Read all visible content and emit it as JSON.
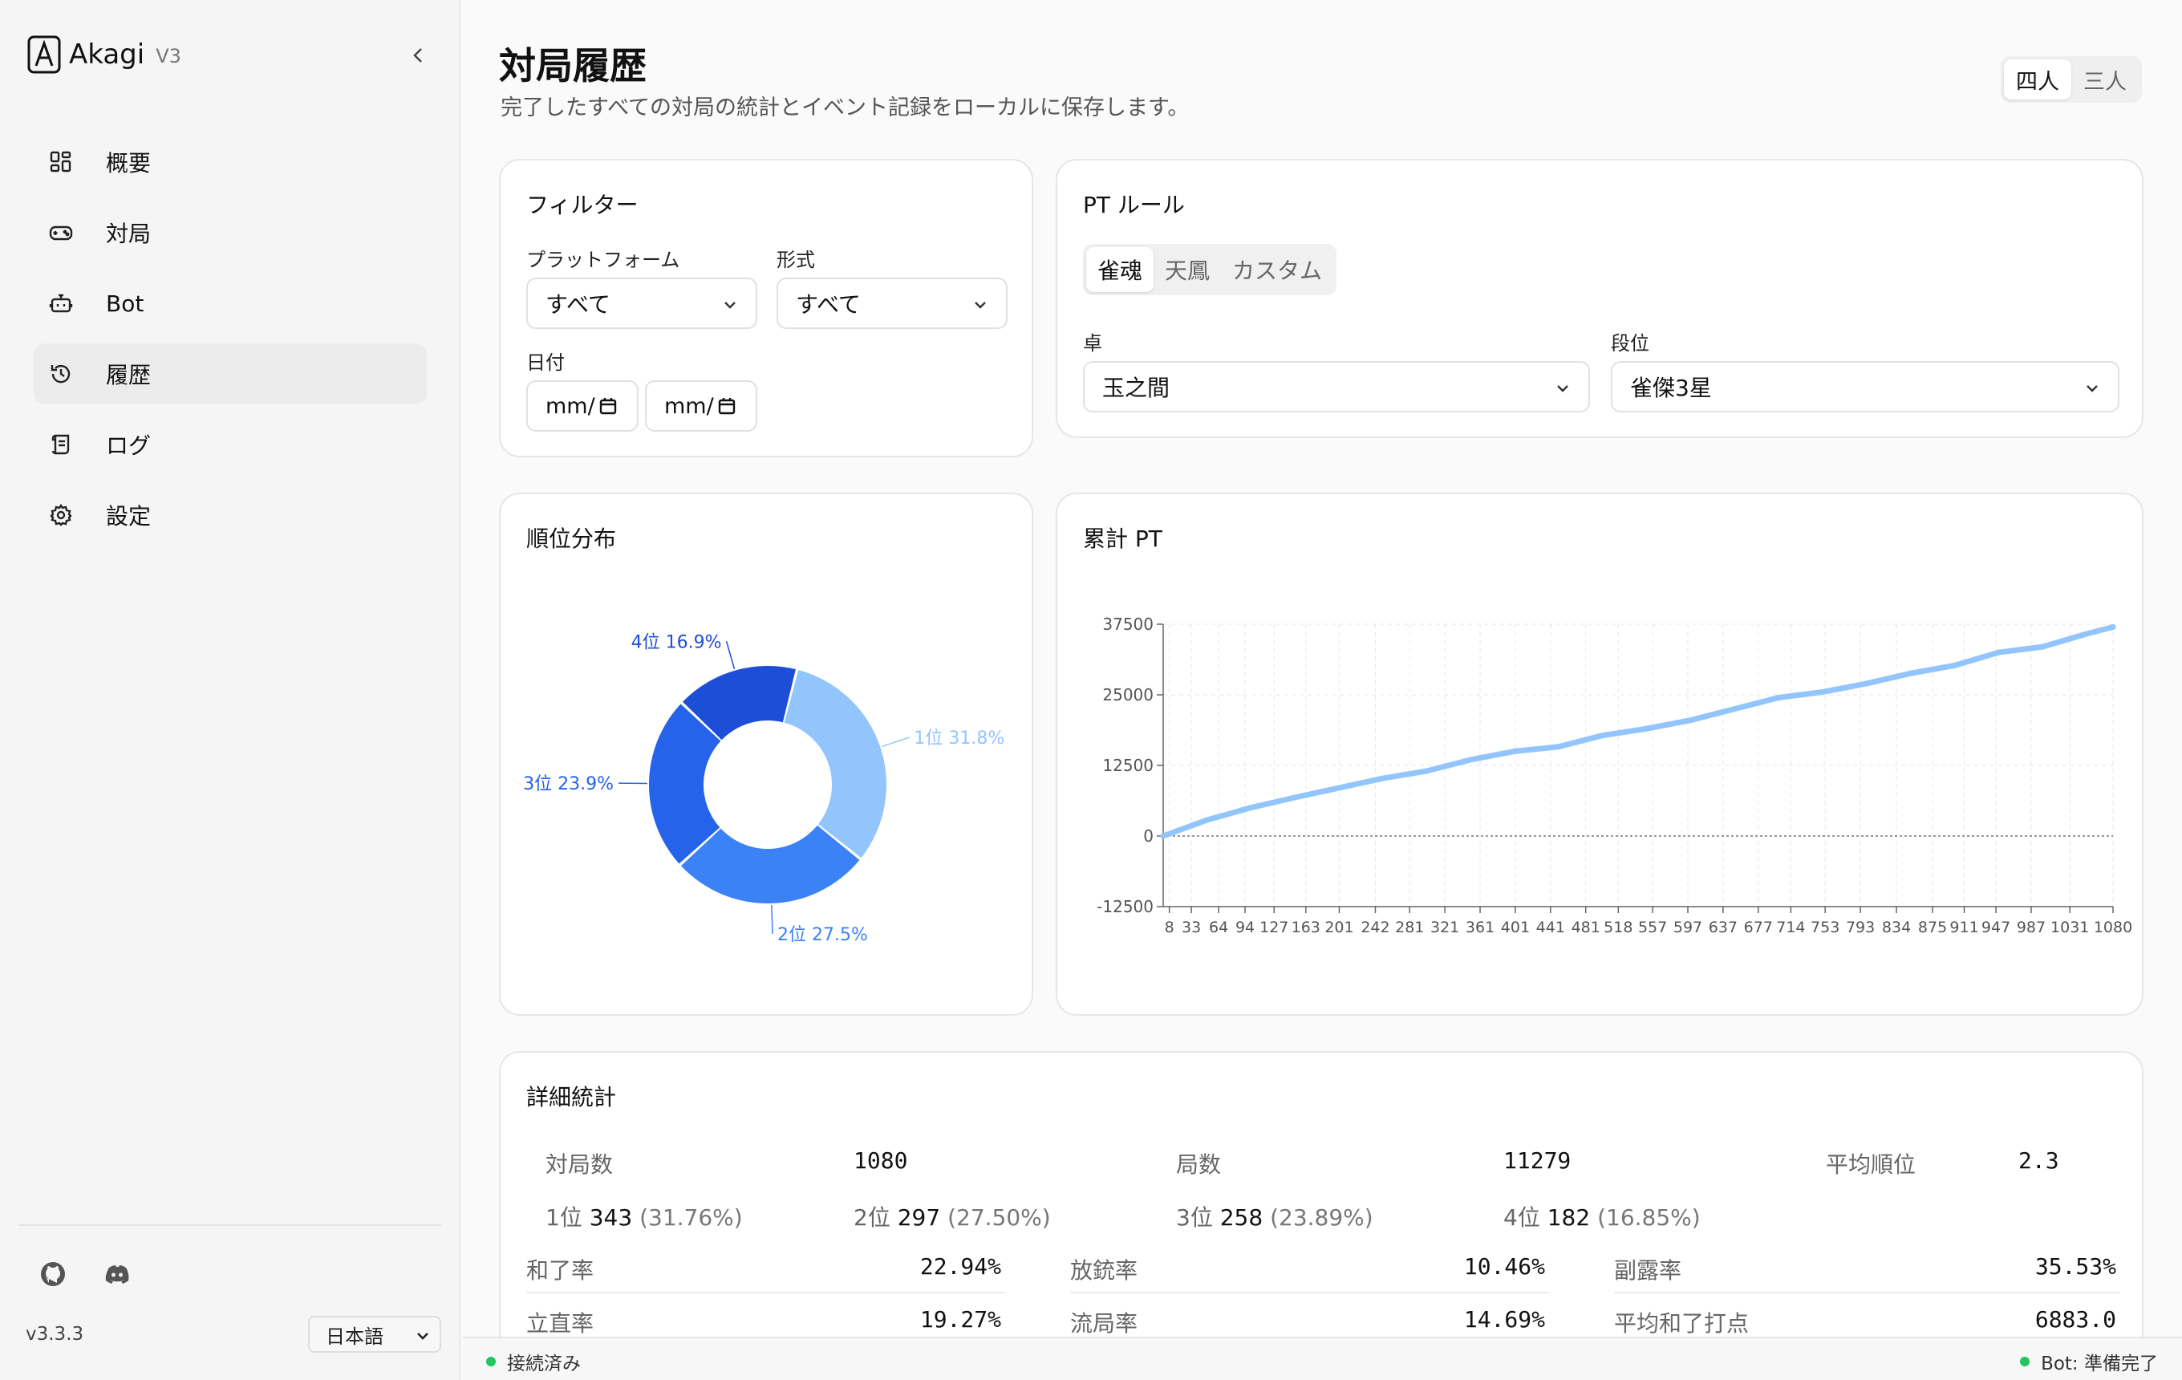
{
  "app": {
    "name": "Akagi",
    "version_badge": "V3",
    "app_version": "v3.3.3",
    "language": "日本語"
  },
  "sidebar": {
    "items": [
      {
        "label": "概要",
        "icon": "dashboard-icon"
      },
      {
        "label": "対局",
        "icon": "gamepad-icon"
      },
      {
        "label": "Bot",
        "icon": "bot-icon"
      },
      {
        "label": "履歴",
        "icon": "history-icon",
        "active": true
      },
      {
        "label": "ログ",
        "icon": "scroll-icon"
      },
      {
        "label": "設定",
        "icon": "gear-icon"
      }
    ]
  },
  "header": {
    "title": "対局履歴",
    "subtitle": "完了したすべての対局の統計とイベント記録をローカルに保存します。",
    "modes": [
      "四人",
      "三人"
    ],
    "active_mode": "四人"
  },
  "filter": {
    "title": "フィルター",
    "platform_label": "プラットフォーム",
    "platform_value": "すべて",
    "format_label": "形式",
    "format_value": "すべて",
    "date_label": "日付",
    "date_from": "mm/",
    "date_to": "mm/"
  },
  "pt_rule": {
    "title": "PT ルール",
    "tabs": [
      "雀魂",
      "天鳳",
      "カスタム"
    ],
    "active_tab": "雀魂",
    "table_label": "卓",
    "table_value": "玉之間",
    "rank_label": "段位",
    "rank_value": "雀傑3星"
  },
  "rank_card": {
    "title": "順位分布"
  },
  "pt_card": {
    "title": "累計 PT"
  },
  "chart_data": [
    {
      "type": "pie",
      "title": "順位分布",
      "categories": [
        "1位",
        "2位",
        "3位",
        "4位"
      ],
      "values": [
        31.8,
        27.5,
        23.9,
        16.9
      ],
      "labels": [
        "1位 31.8%",
        "2位 27.5%",
        "3位 23.9%",
        "4位 16.9%"
      ],
      "colors": [
        "#93c5fd",
        "#3b82f6",
        "#2563eb",
        "#1d4ed8"
      ]
    },
    {
      "type": "line",
      "title": "累計 PT",
      "x_ticks": [
        8,
        33,
        64,
        94,
        127,
        163,
        201,
        242,
        281,
        321,
        361,
        401,
        441,
        481,
        518,
        557,
        597,
        637,
        677,
        714,
        753,
        793,
        834,
        875,
        911,
        947,
        987,
        1031,
        1080
      ],
      "y_ticks": [
        -12500,
        0,
        12500,
        25000,
        37500
      ],
      "ylim": [
        -12500,
        37500
      ],
      "xlim": [
        1,
        1080
      ],
      "grid": true,
      "color": "#93c5fd",
      "series": [
        {
          "x": [
            1,
            50,
            100,
            150,
            200,
            250,
            300,
            350,
            400,
            450,
            500,
            550,
            600,
            650,
            700,
            750,
            800,
            850,
            900,
            950,
            1000,
            1050,
            1080
          ],
          "values": [
            0,
            2800,
            5000,
            6800,
            8500,
            10200,
            11500,
            13500,
            15000,
            15800,
            17800,
            19000,
            20500,
            22500,
            24500,
            25500,
            27000,
            28800,
            30200,
            32500,
            33500,
            35800,
            37000
          ]
        }
      ]
    }
  ],
  "details": {
    "title": "詳細統計",
    "games_label": "対局数",
    "games_value": "1080",
    "rounds_label": "局数",
    "rounds_value": "11279",
    "avg_rank_label": "平均順位",
    "avg_rank_value": "2.3",
    "places": [
      {
        "label": "1位",
        "count": "343",
        "pct": "(31.76%)"
      },
      {
        "label": "2位",
        "count": "297",
        "pct": "(27.50%)"
      },
      {
        "label": "3位",
        "count": "258",
        "pct": "(23.89%)"
      },
      {
        "label": "4位",
        "count": "182",
        "pct": "(16.85%)"
      }
    ],
    "rates": [
      {
        "label": "和了率",
        "value": "22.94%"
      },
      {
        "label": "放銃率",
        "value": "10.46%"
      },
      {
        "label": "副露率",
        "value": "35.53%"
      },
      {
        "label": "立直率",
        "value": "19.27%"
      },
      {
        "label": "流局率",
        "value": "14.69%"
      },
      {
        "label": "平均和了打点",
        "value": "6883.0"
      }
    ]
  },
  "status": {
    "left": "接続済み",
    "right": "Bot: 準備完了"
  }
}
